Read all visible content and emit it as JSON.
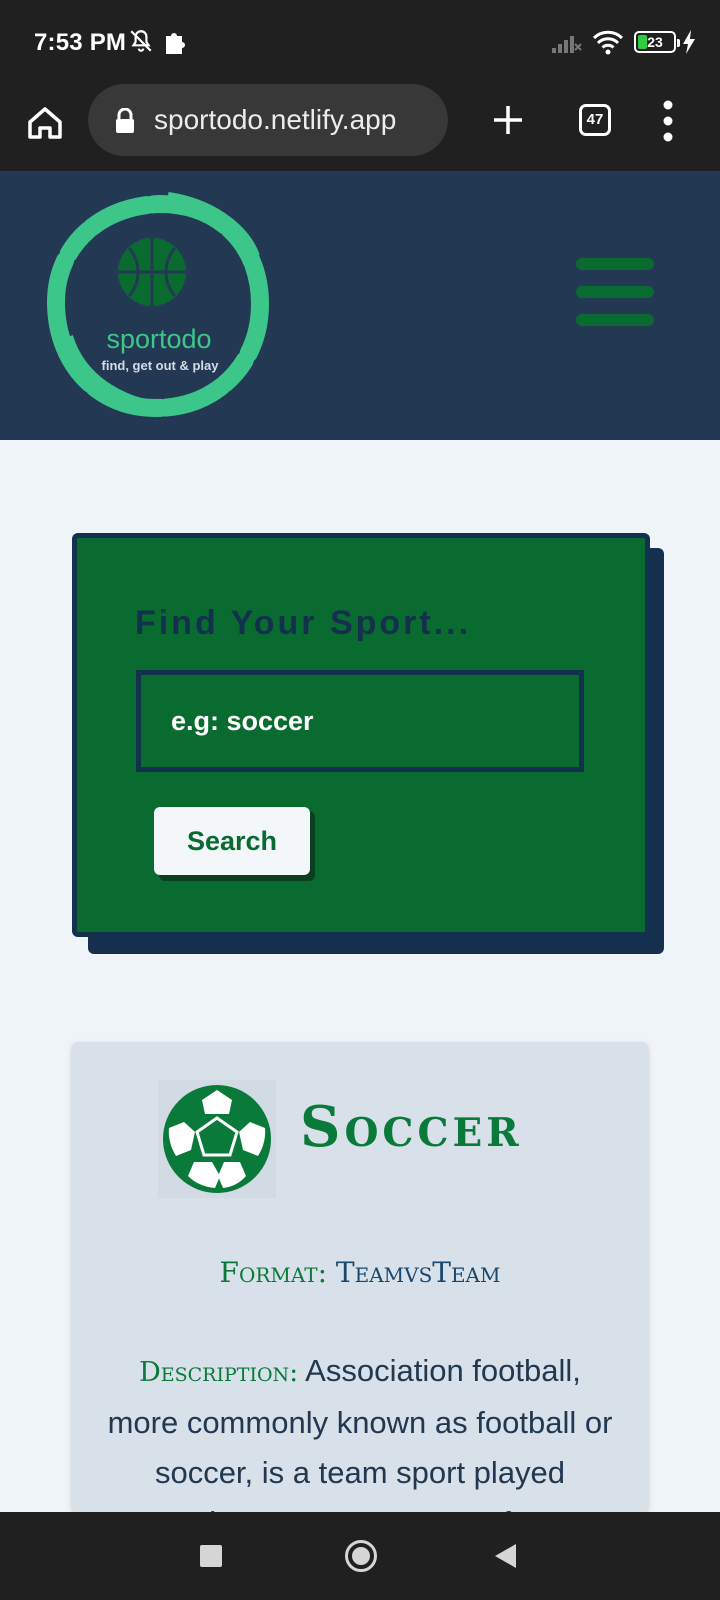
{
  "status_bar": {
    "time": "7:53 PM",
    "battery_level": "23",
    "icons": [
      "notifications-off-icon",
      "puzzle-icon",
      "signal-icon",
      "wifi-icon",
      "battery-icon",
      "charging-bolt-icon"
    ]
  },
  "browser": {
    "url": "sportodo.netlify.app",
    "tab_count": "47",
    "icons": [
      "home-icon",
      "lock-icon",
      "plus-icon",
      "tabs-icon",
      "more-vert-icon"
    ]
  },
  "header": {
    "logo_name": "sportodo",
    "logo_tagline": "find, get out & play",
    "menu_icon": "hamburger-icon"
  },
  "search": {
    "title": "Find Your Sport...",
    "placeholder": "e.g: soccer",
    "button_label": "Search"
  },
  "sport": {
    "name": "Soccer",
    "icon": "soccer-ball-icon",
    "format_label": "Format:",
    "format_value": "TeamvsTeam",
    "description_label": "Description:",
    "description_text": "Association football, more commonly known as football or soccer, is a team sport played between two teams of"
  },
  "nav": {
    "icons": [
      "recents-icon",
      "home-circle-icon",
      "back-icon"
    ]
  },
  "colors": {
    "header_bg": "#233953",
    "brand_green": "#0a6b30",
    "logo_accent": "#3cc68a",
    "card_bg": "#d8e0e9",
    "page_bg": "#eff4f8"
  }
}
